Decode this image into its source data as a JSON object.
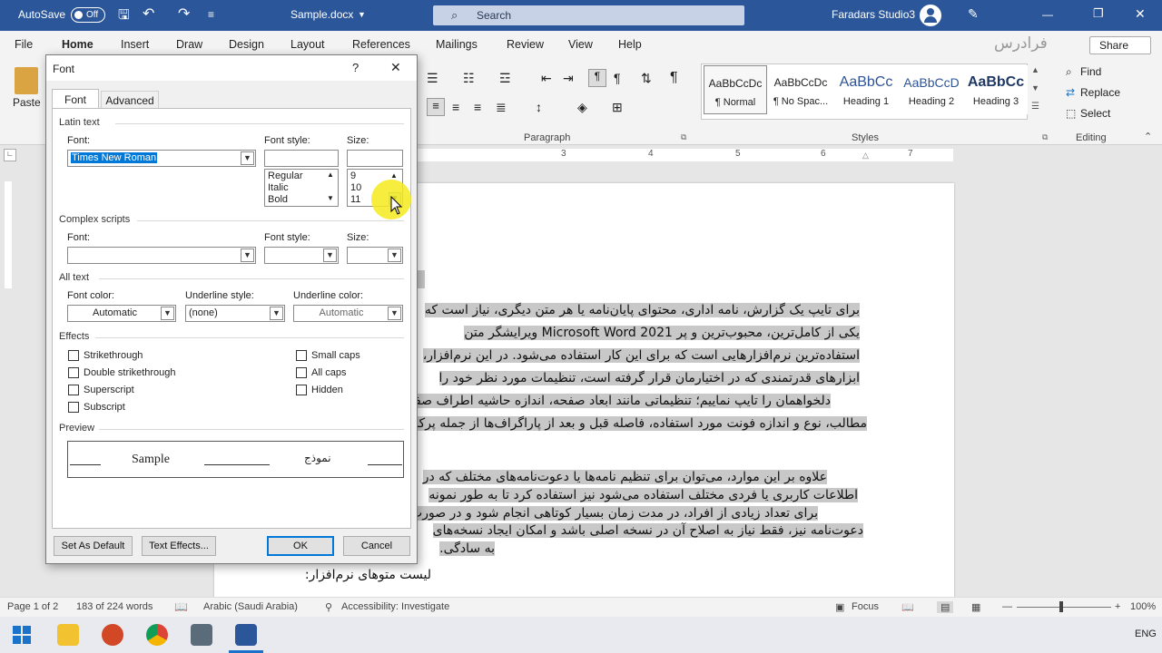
{
  "titlebar": {
    "autosave": "AutoSave",
    "autosave_state": "Off",
    "doc_title": "Sample.docx",
    "search_placeholder": "Search",
    "user": "Faradars Studio3"
  },
  "menu": [
    "File",
    "Home",
    "Insert",
    "Draw",
    "Design",
    "Layout",
    "References",
    "Mailings",
    "Review",
    "View",
    "Help"
  ],
  "share_label": "Share",
  "watermark": "فرادرس",
  "ribbon": {
    "paste": "Paste",
    "paragraph_label": "Paragraph",
    "styles_label": "Styles",
    "editing_label": "Editing",
    "styles": [
      {
        "preview": "AaBbCcDc",
        "name": "¶ Normal"
      },
      {
        "preview": "AaBbCcDc",
        "name": "¶ No Spac..."
      },
      {
        "preview": "AaBbCc",
        "name": "Heading 1"
      },
      {
        "preview": "AaBbCcD",
        "name": "Heading 2"
      },
      {
        "preview": "AaBbCc",
        "name": "Heading 3"
      }
    ],
    "editing": [
      "Find",
      "Replace",
      "Select"
    ],
    "ruler_numbers": [
      "3",
      "4",
      "5",
      "6",
      "7"
    ]
  },
  "dialog": {
    "title": "Font",
    "help": "?",
    "tabs": [
      "Font",
      "Advanced"
    ],
    "latin_section": "Latin text",
    "font_label": "Font:",
    "font_style_label": "Font style:",
    "size_label": "Size:",
    "font_value": "Times New Roman",
    "style_options": [
      "Regular",
      "Italic",
      "Bold"
    ],
    "size_options": [
      "9",
      "10",
      "11"
    ],
    "complex_section": "Complex scripts",
    "complex_font_label": "Font:",
    "complex_style_label": "Font style:",
    "complex_size_label": "Size:",
    "alltext_section": "All text",
    "font_color_label": "Font color:",
    "font_color_value": "Automatic",
    "underline_style_label": "Underline style:",
    "underline_style_value": "(none)",
    "underline_color_label": "Underline color:",
    "underline_color_value": "Automatic",
    "effects_section": "Effects",
    "effects_left": [
      "Strikethrough",
      "Double strikethrough",
      "Superscript",
      "Subscript"
    ],
    "effects_right": [
      "Small caps",
      "All caps",
      "Hidden"
    ],
    "preview_section": "Preview",
    "preview_latin": "Sample",
    "preview_complex": "نموذج",
    "buttons": {
      "set_default": "Set As Default",
      "text_effects": "Text Effects...",
      "ok": "OK",
      "cancel": "Cancel"
    }
  },
  "document": {
    "lines": [
      "برای تایپ یک گزارش، نامه اداری، محتوای پایان‌نامه یا هر متن دیگری، نیاز است که",
      "یکی از کامل‌ترین، محبوب‌ترین و پر Microsoft Word 2021 ویرایشگر متن",
      "استفاده‌ترین نرم‌افزارهایی است که برای این کار استفاده می‌شود. در این نرم‌افزار،",
      "ابزارهای قدرتمندی که در اختیارمان قرار گرفته است، تنظیمات مورد نظر خود را",
      "دلخواهمان را تایپ نماییم؛ تنظیماتی مانند ابعاد صفحه، اندازه حاشیه اطراف صفحه",
      "مطالب، نوع و اندازه فونت مورد استفاده، فاصله قبل و بعد از پاراگراف‌ها از جمله پرکاربر",
      "علاوه بر این موارد، می‌توان برای تنظیم نامه‌ها یا دعوت‌نامه‌های مختلف که در",
      "اطلاعات کاربری یا فردی مختلف استفاده می‌شود نیز استفاده کرد تا به طور نمونه",
      "برای تعداد زیادی از افراد، در مدت زمان بسیار کوتاهی انجام شود و در صورت",
      "دعوت‌نامه نیز، فقط نیاز به اصلاح آن در نسخه اصلی باشد و امکان ایجاد نسخه‌های",
      "به سادگی.",
      "لیست متوهای نرم‌افزار:"
    ]
  },
  "status": {
    "page": "Page 1 of 2",
    "words": "183 of 224 words",
    "language": "Arabic (Saudi Arabia)",
    "accessibility": "Accessibility: Investigate",
    "focus": "Focus",
    "zoom": "100%"
  },
  "taskbar": {
    "lang": "ENG"
  },
  "colors": {
    "titlebar": "#2b579a",
    "accent": "#1a73c8",
    "highlight": "#f5ea1c"
  }
}
